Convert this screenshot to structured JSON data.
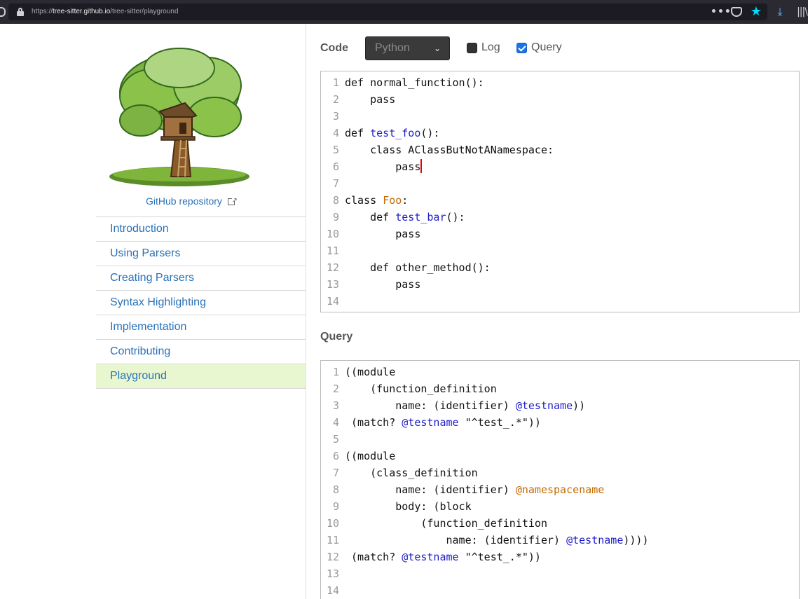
{
  "browser": {
    "url_prefix": "https://",
    "url_host": "tree-sitter.github.io",
    "url_path": "/tree-sitter/playground",
    "icons": [
      "shield-icon",
      "lock-icon",
      "more-icon",
      "pocket-icon",
      "bookmark-star-icon",
      "download-icon",
      "library-icon"
    ]
  },
  "sidebar": {
    "repo_link": "GitHub repository",
    "nav": [
      {
        "label": "Introduction",
        "active": false
      },
      {
        "label": "Using Parsers",
        "active": false
      },
      {
        "label": "Creating Parsers",
        "active": false
      },
      {
        "label": "Syntax Highlighting",
        "active": false
      },
      {
        "label": "Implementation",
        "active": false
      },
      {
        "label": "Contributing",
        "active": false
      },
      {
        "label": "Playground",
        "active": true
      }
    ]
  },
  "main": {
    "code_label": "Code",
    "language": "Python",
    "log_label": "Log",
    "log_checked": false,
    "query_checkbox_label": "Query",
    "query_checked": true,
    "query_label": "Query",
    "code_lines": [
      [
        {
          "t": "def normal_function():",
          "c": "kw"
        }
      ],
      [
        {
          "t": "    pass",
          "c": "kw"
        }
      ],
      [],
      [
        {
          "t": "def ",
          "c": "kw"
        },
        {
          "t": "test_foo",
          "c": "fn"
        },
        {
          "t": "():",
          "c": "kw"
        }
      ],
      [
        {
          "t": "    class AClassButNotANamespace:",
          "c": "kw"
        }
      ],
      [
        {
          "t": "        pass",
          "c": "kw"
        },
        {
          "t": "",
          "c": "cursor"
        }
      ],
      [],
      [
        {
          "t": "class ",
          "c": "kw"
        },
        {
          "t": "Foo",
          "c": "cls"
        },
        {
          "t": ":",
          "c": "kw"
        }
      ],
      [
        {
          "t": "    def ",
          "c": "kw"
        },
        {
          "t": "test_bar",
          "c": "fn"
        },
        {
          "t": "():",
          "c": "kw"
        }
      ],
      [
        {
          "t": "        pass",
          "c": "kw"
        }
      ],
      [],
      [
        {
          "t": "    def other_method():",
          "c": "kw"
        }
      ],
      [
        {
          "t": "        pass",
          "c": "kw"
        }
      ],
      []
    ],
    "query_lines": [
      [
        {
          "t": "((module",
          "c": "kw"
        }
      ],
      [
        {
          "t": "    (function_definition",
          "c": "kw"
        }
      ],
      [
        {
          "t": "        name: (identifier) ",
          "c": "kw"
        },
        {
          "t": "@testname",
          "c": "cap"
        },
        {
          "t": "))",
          "c": "kw"
        }
      ],
      [
        {
          "t": " (match? ",
          "c": "kw"
        },
        {
          "t": "@testname",
          "c": "cap"
        },
        {
          "t": " \"^test_.*\"))",
          "c": "kw"
        }
      ],
      [],
      [
        {
          "t": "((module",
          "c": "kw"
        }
      ],
      [
        {
          "t": "    (class_definition",
          "c": "kw"
        }
      ],
      [
        {
          "t": "        name: (identifier) ",
          "c": "kw"
        },
        {
          "t": "@namespacename",
          "c": "cap2"
        }
      ],
      [
        {
          "t": "        body: (block",
          "c": "kw"
        }
      ],
      [
        {
          "t": "            (function_definition",
          "c": "kw"
        }
      ],
      [
        {
          "t": "                name: (identifier) ",
          "c": "kw"
        },
        {
          "t": "@testname",
          "c": "cap"
        },
        {
          "t": "))))",
          "c": "kw"
        }
      ],
      [
        {
          "t": " (match? ",
          "c": "kw"
        },
        {
          "t": "@testname",
          "c": "cap"
        },
        {
          "t": " \"^test_.*\"))",
          "c": "kw"
        }
      ],
      [],
      []
    ]
  }
}
